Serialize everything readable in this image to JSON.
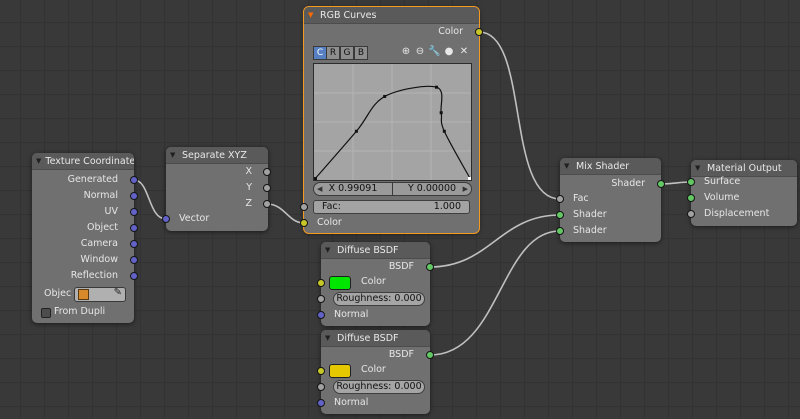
{
  "colors": {
    "wire": "#c0c0c0",
    "socket_yellow": "#c7c729",
    "socket_gray": "#a1a1a1",
    "socket_blue": "#6363c7",
    "socket_green": "#63c763",
    "diffuse1_color": "#00e600",
    "diffuse2_color": "#e6c800",
    "selected_outline": "#f59a20"
  },
  "texture_coordinate": {
    "title": "Texture Coordinate",
    "outputs": [
      "Generated",
      "Normal",
      "UV",
      "Object",
      "Camera",
      "Window",
      "Reflection"
    ],
    "object_label": "Objec",
    "from_dupli_label": "From Dupli"
  },
  "separate_xyz": {
    "title": "Separate XYZ",
    "outputs": [
      "X",
      "Y",
      "Z"
    ],
    "input_label": "Vector"
  },
  "rgb_curves": {
    "title": "RGB Curves",
    "output_label": "Color",
    "channel_tabs": [
      "C",
      "R",
      "G",
      "B"
    ],
    "tool_icons": [
      "zoom-in-icon",
      "zoom-out-icon",
      "wrench-icon",
      "point-icon",
      "close-icon"
    ],
    "x_label": "X 0.99091",
    "y_label": "Y 0.00000",
    "fac_label": "Fac:",
    "fac_value": "1.000",
    "color_input_label": "Color",
    "curve_points": [
      [
        0.0,
        0.0
      ],
      [
        0.27,
        0.42
      ],
      [
        0.45,
        0.72
      ],
      [
        0.78,
        0.8
      ],
      [
        0.81,
        0.58
      ],
      [
        0.83,
        0.42
      ],
      [
        1.0,
        0.0
      ]
    ]
  },
  "diffuse_1": {
    "title": "Diffuse BSDF",
    "output_label": "BSDF",
    "color_label": "Color",
    "roughness_label": "Roughness:",
    "roughness_value": "0.000",
    "normal_label": "Normal"
  },
  "diffuse_2": {
    "title": "Diffuse BSDF",
    "output_label": "BSDF",
    "color_label": "Color",
    "roughness_label": "Roughness:",
    "roughness_value": "0.000",
    "normal_label": "Normal"
  },
  "mix_shader": {
    "title": "Mix Shader",
    "output_label": "Shader",
    "inputs": [
      "Fac",
      "Shader",
      "Shader"
    ]
  },
  "material_output": {
    "title": "Material Output",
    "inputs": [
      "Surface",
      "Volume",
      "Displacement"
    ]
  }
}
